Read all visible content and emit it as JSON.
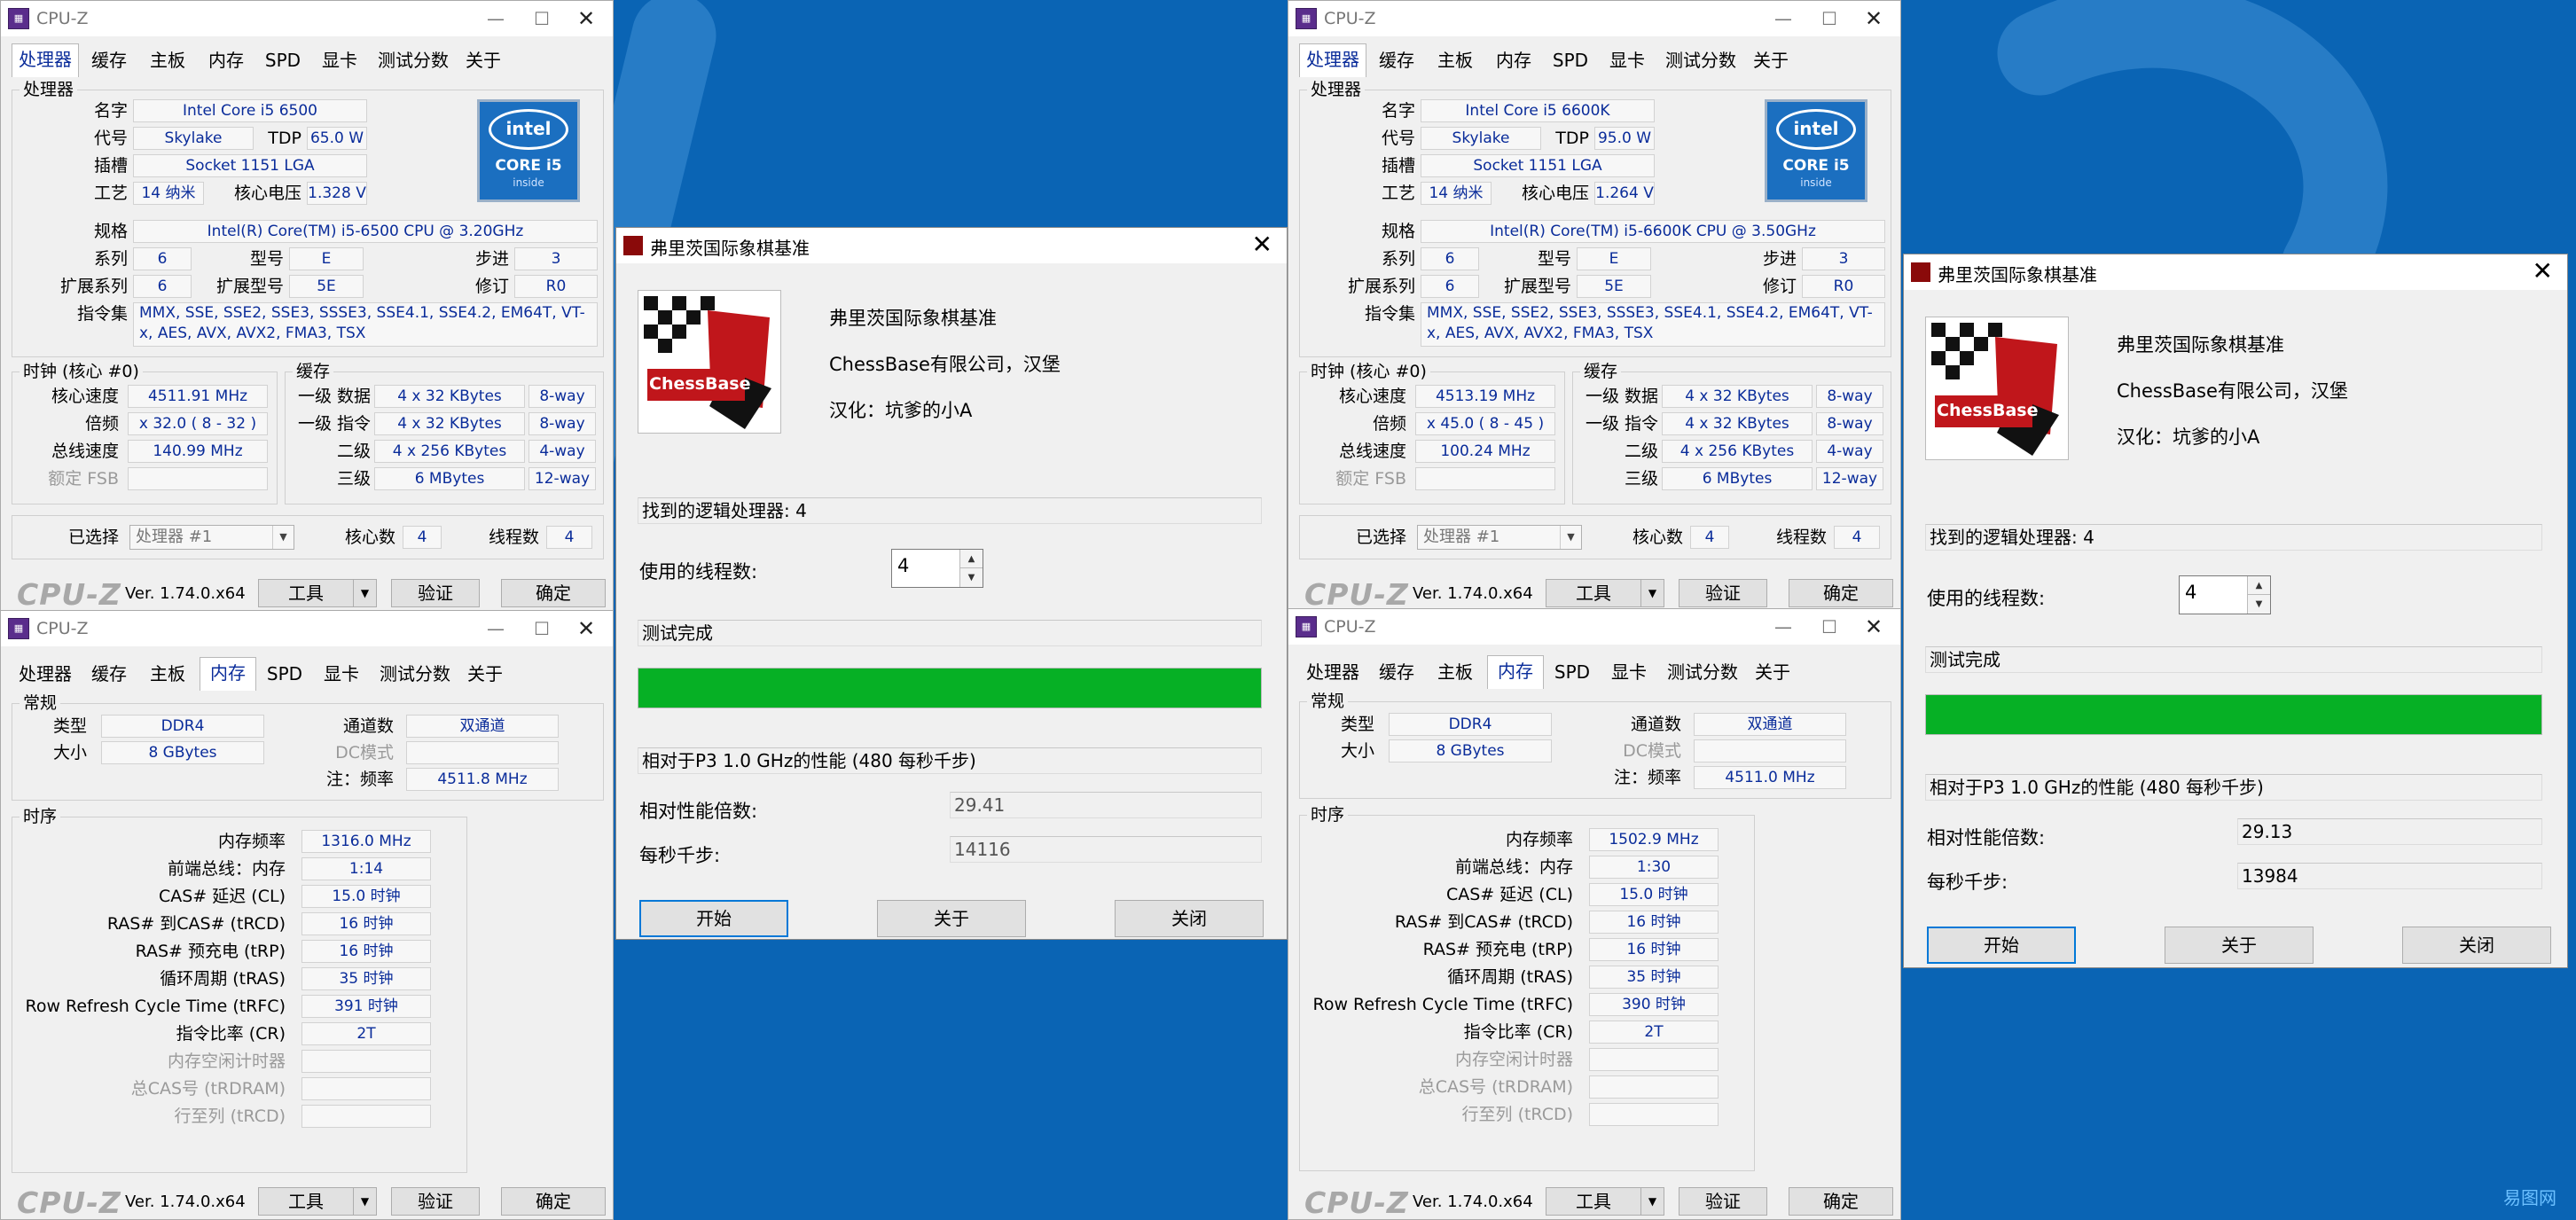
{
  "colors": {
    "desktop": "#0a64b4",
    "window": "#f0f0f0",
    "value_text": "#0a2c9a",
    "progress": "#06b025",
    "accent": "#0078d7"
  },
  "cpuz": {
    "app_title": "CPU-Z",
    "tabs": [
      "处理器",
      "缓存",
      "主板",
      "内存",
      "SPD",
      "显卡",
      "测试分数",
      "关于"
    ],
    "footer": {
      "logo": "CPU-Z",
      "version": "Ver. 1.74.0.x64",
      "tools": "工具",
      "validate": "验证",
      "ok": "确定"
    }
  },
  "labels": {
    "cpu": {
      "processor": "处理器",
      "name": "名字",
      "codename": "代号",
      "tdp": "TDP",
      "package": "插槽",
      "technology": "工艺",
      "voltage": "核心电压",
      "spec": "规格",
      "family": "系列",
      "model": "型号",
      "stepping": "步进",
      "ext_family": "扩展系列",
      "ext_model": "扩展型号",
      "revision": "修订",
      "instructions": "指令集",
      "clocks": "时钟 (核心 #0)",
      "core_speed": "核心速度",
      "multiplier": "倍频",
      "bus_speed": "总线速度",
      "rated_fsb": "额定 FSB",
      "cache": "缓存",
      "l1d": "一级 数据",
      "l1i": "一级 指令",
      "l2": "二级",
      "l3": "三级",
      "selection": "已选择",
      "cores": "核心数",
      "threads": "线程数"
    },
    "mem": {
      "general": "常规",
      "type": "类型",
      "size": "大小",
      "channel": "通道数",
      "dc_mode": "DC模式",
      "nb_freq": "注：频率",
      "timings": "时序",
      "dram_freq": "内存频率",
      "fsb_dram": "前端总线：内存",
      "cl": "CAS# 延迟 (CL)",
      "trcd": "RAS# 到CAS# (tRCD)",
      "trp": "RAS# 预充电 (tRP)",
      "tras": "循环周期 (tRAS)",
      "trfc": "Row Refresh Cycle Time (tRFC)",
      "cr": "指令比率 (CR)",
      "idle_timer": "内存空闲计时器",
      "trdram": "总CAS号 (tRDRAM)",
      "trcd2": "行至列 (tRCD)"
    },
    "bench": {
      "logical": "找到的逻辑处理器: ",
      "threads": "使用的线程数:",
      "status": "测试完成",
      "relative": "相对于P3 1.0 GHz的性能 (480 每秒千步)",
      "factor": "相对性能倍数:",
      "kns": "每秒千步:",
      "start": "开始",
      "about": "关于",
      "close": "关闭"
    }
  },
  "cpu1": {
    "name": "Intel Core i5 6500",
    "codename": "Skylake",
    "tdp": "65.0 W",
    "package": "Socket 1151 LGA",
    "technology": "14 纳米",
    "voltage": "1.328 V",
    "spec": "Intel(R) Core(TM) i5-6500 CPU @ 3.20GHz",
    "family": "6",
    "model": "E",
    "stepping": "3",
    "ext_family": "6",
    "ext_model": "5E",
    "revision": "R0",
    "instructions": "MMX, SSE, SSE2, SSE3, SSSE3, SSE4.1, SSE4.2, EM64T, VT-x, AES, AVX, AVX2, FMA3, TSX",
    "core_speed": "4511.91 MHz",
    "multiplier": "x 32.0 ( 8 - 32 )",
    "bus_speed": "140.99 MHz",
    "rated_fsb": "",
    "l1d": "4 x 32 KBytes",
    "l1d_way": "8-way",
    "l1i": "4 x 32 KBytes",
    "l1i_way": "8-way",
    "l2": "4 x 256 KBytes",
    "l2_way": "4-way",
    "l3": "6 MBytes",
    "l3_way": "12-way",
    "selection": "处理器 #1",
    "cores": "4",
    "threads": "4",
    "intel": {
      "brand": "intel",
      "line": "CORE i5",
      "sub": "inside"
    }
  },
  "mem1": {
    "type": "DDR4",
    "size": "8 GBytes",
    "channel": "双通道",
    "dc_mode": "",
    "nb_freq": "4511.8 MHz",
    "dram_freq": "1316.0 MHz",
    "fsb_dram": "1:14",
    "cl": "15.0 时钟",
    "trcd": "16 时钟",
    "trp": "16 时钟",
    "tras": "35 时钟",
    "trfc": "391 时钟",
    "cr": "2T",
    "idle_timer": "",
    "trdram": "",
    "trcd2": ""
  },
  "bench1": {
    "title": "弗里茨国际象棋基准",
    "app": "弗里茨国际象棋基准",
    "company": "ChessBase有限公司，汉堡",
    "localized": "汉化：坑爹的小A",
    "logo": "ChessBase",
    "logical": "4",
    "threads": "4",
    "progress": 1.0,
    "factor": "29.41",
    "kns": "14116"
  },
  "cpu2": {
    "name": "Intel Core i5 6600K",
    "codename": "Skylake",
    "tdp": "95.0 W",
    "package": "Socket 1151 LGA",
    "technology": "14 纳米",
    "voltage": "1.264 V",
    "spec": "Intel(R) Core(TM) i5-6600K CPU @ 3.50GHz",
    "family": "6",
    "model": "E",
    "stepping": "3",
    "ext_family": "6",
    "ext_model": "5E",
    "revision": "R0",
    "instructions": "MMX, SSE, SSE2, SSE3, SSSE3, SSE4.1, SSE4.2, EM64T, VT-x, AES, AVX, AVX2, FMA3, TSX",
    "core_speed": "4513.19 MHz",
    "multiplier": "x 45.0 ( 8 - 45 )",
    "bus_speed": "100.24 MHz",
    "rated_fsb": "",
    "l1d": "4 x 32 KBytes",
    "l1d_way": "8-way",
    "l1i": "4 x 32 KBytes",
    "l1i_way": "8-way",
    "l2": "4 x 256 KBytes",
    "l2_way": "4-way",
    "l3": "6 MBytes",
    "l3_way": "12-way",
    "selection": "处理器 #1",
    "cores": "4",
    "threads": "4",
    "intel": {
      "brand": "intel",
      "line": "CORE i5",
      "sub": "inside"
    }
  },
  "mem2": {
    "type": "DDR4",
    "size": "8 GBytes",
    "channel": "双通道",
    "dc_mode": "",
    "nb_freq": "4511.0 MHz",
    "dram_freq": "1502.9 MHz",
    "fsb_dram": "1:30",
    "cl": "15.0 时钟",
    "trcd": "16 时钟",
    "trp": "16 时钟",
    "tras": "35 时钟",
    "trfc": "390 时钟",
    "cr": "2T",
    "idle_timer": "",
    "trdram": "",
    "trcd2": ""
  },
  "bench2": {
    "title": "弗里茨国际象棋基准",
    "app": "弗里茨国际象棋基准",
    "company": "ChessBase有限公司，汉堡",
    "localized": "汉化：坑爹的小A",
    "logo": "ChessBase",
    "logical": "4",
    "threads": "4",
    "progress": 1.0,
    "factor": "29.13",
    "kns": "13984"
  },
  "watermark": "易图网"
}
